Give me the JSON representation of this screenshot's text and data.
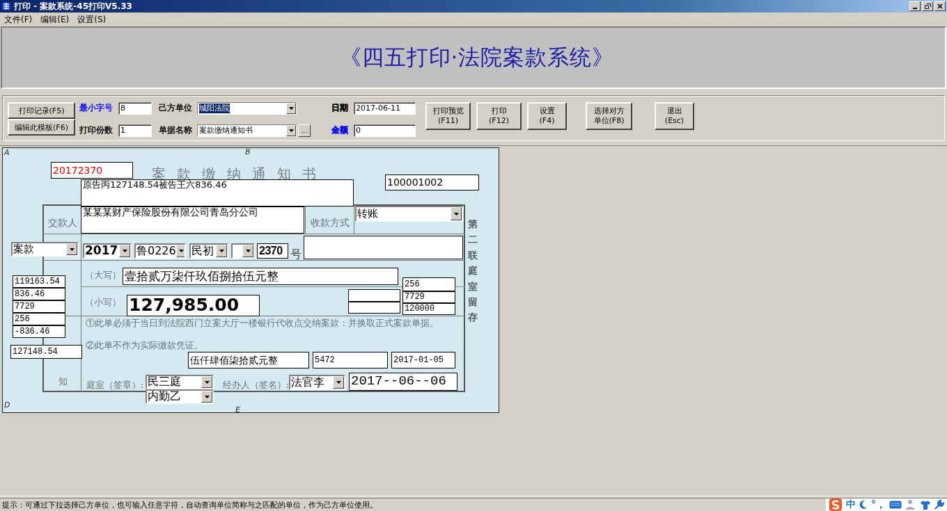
{
  "window": {
    "title": "打印 - 案款系统-45打印V5.33"
  },
  "menu": [
    "文件(F)",
    "编辑(E)",
    "设置(S)"
  ],
  "banner": {
    "title": "《四五打印·法院案款系统》"
  },
  "toolbar": {
    "left_buttons": [
      {
        "label": "打印记录(F5)"
      },
      {
        "label": "编辑此模板(F6)"
      }
    ],
    "fields": [
      {
        "label": "最小字号",
        "color": "#0000ff",
        "bold": false,
        "kind": "input",
        "value": "8"
      },
      {
        "label": "打印份数",
        "color": "#000000",
        "bold": false,
        "kind": "input",
        "value": "1"
      },
      {
        "label": "己方单位",
        "color": "#000000",
        "bold": false,
        "kind": "select",
        "value": "城阳法院",
        "highlighted": true
      },
      {
        "label": "单据名称",
        "color": "#000000",
        "bold": false,
        "kind": "select",
        "value": "案款缴纳通知书",
        "highlighted": false,
        "more": "..."
      },
      {
        "label": "日期",
        "color": "#000000",
        "bold": true,
        "kind": "input",
        "value": "2017-06-11"
      },
      {
        "label": "金额",
        "color": "#0000ff",
        "bold": true,
        "kind": "input",
        "value": "0"
      }
    ],
    "buttons": [
      {
        "label": "打印预览",
        "key": "(F11)"
      },
      {
        "label": "打印",
        "key": "(F12)"
      },
      {
        "label": "设置",
        "key": "(F4)"
      },
      {
        "label": "选择对方",
        "key": "单位(F8)"
      },
      {
        "label": "退出",
        "key": "(Esc)"
      }
    ]
  },
  "form": {
    "labels": [
      "案款缴纳通知书",
      "交款人",
      "收款方式",
      "号",
      "（大写）",
      "（小写）",
      "①此单必须于当日到法院西门立案大厅一楼银行代收点交纳案款：并换取正式案款单据。",
      "②此单不作为实际缴款凭证。",
      "知",
      "庭室（签章）:",
      "经办人（签名）:",
      "第二联庭室留存",
      "A",
      "B",
      "D",
      "E"
    ],
    "fields": [
      {
        "kind": "text",
        "value": "20172370"
      },
      {
        "kind": "text",
        "value": "原告丙127148.54被告王六836.46"
      },
      {
        "kind": "text",
        "value": "100001002"
      },
      {
        "kind": "text",
        "value": "某某某财产保险股份有限公司青岛分公司"
      },
      {
        "kind": "select",
        "value": "转账"
      },
      {
        "kind": "select",
        "value": "案款"
      },
      {
        "kind": "select",
        "value": "2017"
      },
      {
        "kind": "select",
        "value": "鲁0226"
      },
      {
        "kind": "select",
        "value": "民初"
      },
      {
        "kind": "select"
      },
      {
        "kind": "text",
        "value": "2370"
      },
      {
        "kind": "text"
      },
      {
        "kind": "text",
        "value": "119163.54"
      },
      {
        "kind": "text",
        "value": "836.46"
      },
      {
        "kind": "text",
        "value": "7729"
      },
      {
        "kind": "text",
        "value": "256"
      },
      {
        "kind": "text",
        "value": "-836.46"
      },
      {
        "kind": "text",
        "value": "壹拾贰万柒仟玖佰捌拾伍元整"
      },
      {
        "kind": "text",
        "value": "127,985.00"
      },
      {
        "kind": "text"
      },
      {
        "kind": "text"
      },
      {
        "kind": "text",
        "value": "256"
      },
      {
        "kind": "text",
        "value": "7729"
      },
      {
        "kind": "text",
        "value": "120000"
      },
      {
        "kind": "text",
        "value": "127148.54"
      },
      {
        "kind": "text",
        "value": "伍仟肆佰柒拾贰元整"
      },
      {
        "kind": "text",
        "value": "5472"
      },
      {
        "kind": "text",
        "value": "2017-01-05"
      },
      {
        "kind": "select",
        "value": "民三庭"
      },
      {
        "kind": "select",
        "value": "内勤乙"
      },
      {
        "kind": "select",
        "value": "法官李"
      },
      {
        "kind": "text",
        "value": "2017--06--06"
      }
    ]
  },
  "status_bar": {
    "text": "提示：可通过下拉选择己方单位，也可输入任意字符，自动查询单位简称与之匹配的单位，作为己方单位使用。"
  },
  "tray": {
    "ime": "中",
    "punct": "°，"
  }
}
